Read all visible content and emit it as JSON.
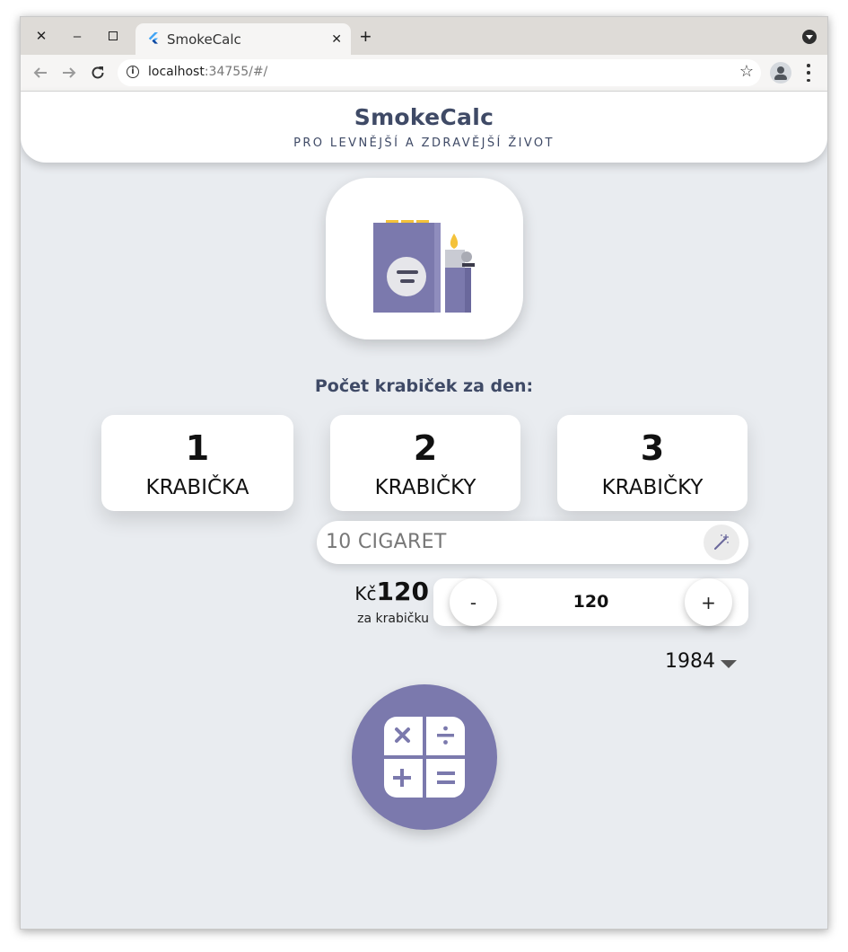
{
  "browser": {
    "tab_title": "SmokeCalc",
    "url_host": "localhost",
    "url_rest": ":34755/#/"
  },
  "header": {
    "title": "SmokeCalc",
    "subtitle": "PRO LEVNĚJŠÍ A ZDRAVĚJŠÍ ŽIVOT"
  },
  "question": "Počet krabiček za den:",
  "packs": [
    {
      "number": "1",
      "unit": "KRABIČKA"
    },
    {
      "number": "2",
      "unit": "KRABIČKY"
    },
    {
      "number": "3",
      "unit": "KRABIČKY"
    }
  ],
  "cigarettes_input": {
    "placeholder": "10 CIGARET"
  },
  "price": {
    "currency": "Kč",
    "value": "120",
    "caption": "za krabičku"
  },
  "stepper": {
    "minus": "-",
    "value": "120",
    "plus": "+"
  },
  "year_select": {
    "value": "1984"
  },
  "colors": {
    "accent": "#7b79ad",
    "heading": "#3f4a66",
    "page_bg": "#e9ecf0"
  },
  "icons": {
    "logo": "cigarette-pack-lighter-icon",
    "calculator": "calculator-icon",
    "input_action": "magic-wand-icon"
  }
}
